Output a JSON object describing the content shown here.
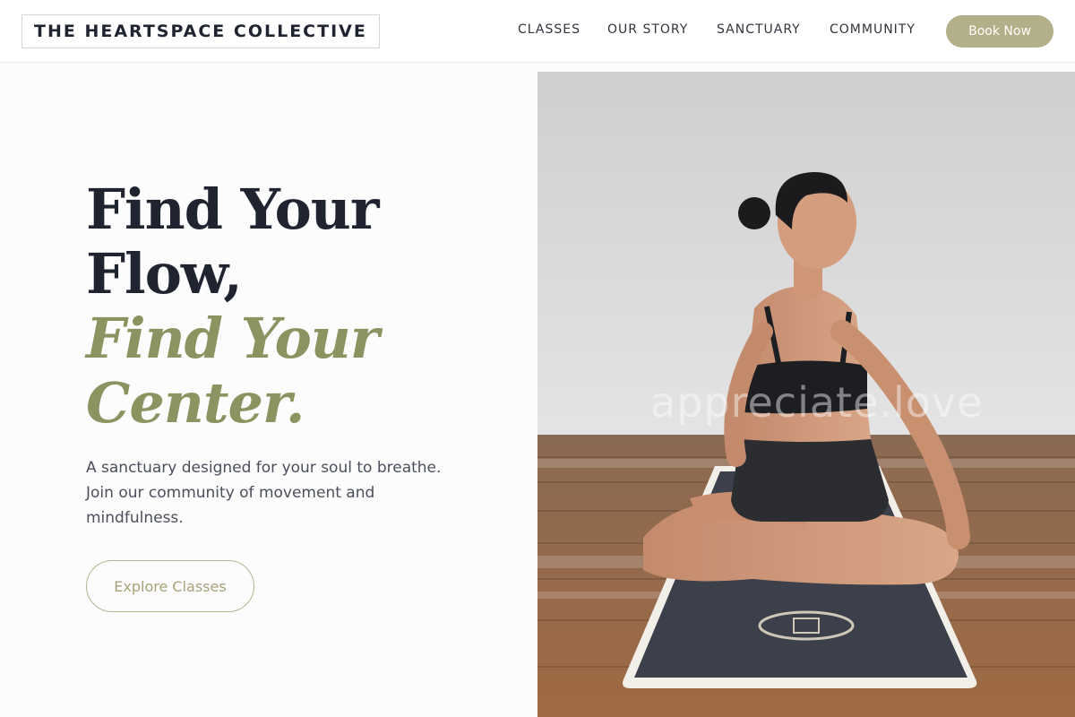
{
  "header": {
    "logo_text": "THE HEARTSPACE COLLECTIVE",
    "nav": [
      {
        "label": "CLASSES"
      },
      {
        "label": "OUR STORY"
      },
      {
        "label": "SANCTUARY"
      },
      {
        "label": "COMMUNITY"
      }
    ],
    "cta_label": "Book Now"
  },
  "hero": {
    "title_line1": "Find Your",
    "title_line2": "Flow,",
    "title_accent_line1": "Find Your",
    "title_accent_line2": "Center.",
    "subtitle": "A sanctuary designed for your soul to breathe. Join our community of movement and mindfulness.",
    "button_label": "Explore Classes",
    "image": {
      "subject": "woman-seated-yoga-twist-on-mat",
      "watermark": "appreciate.love"
    }
  },
  "colors": {
    "accent_olive": "#8a9460",
    "button_khaki": "#b3af88",
    "text_dark": "#1f2430"
  }
}
